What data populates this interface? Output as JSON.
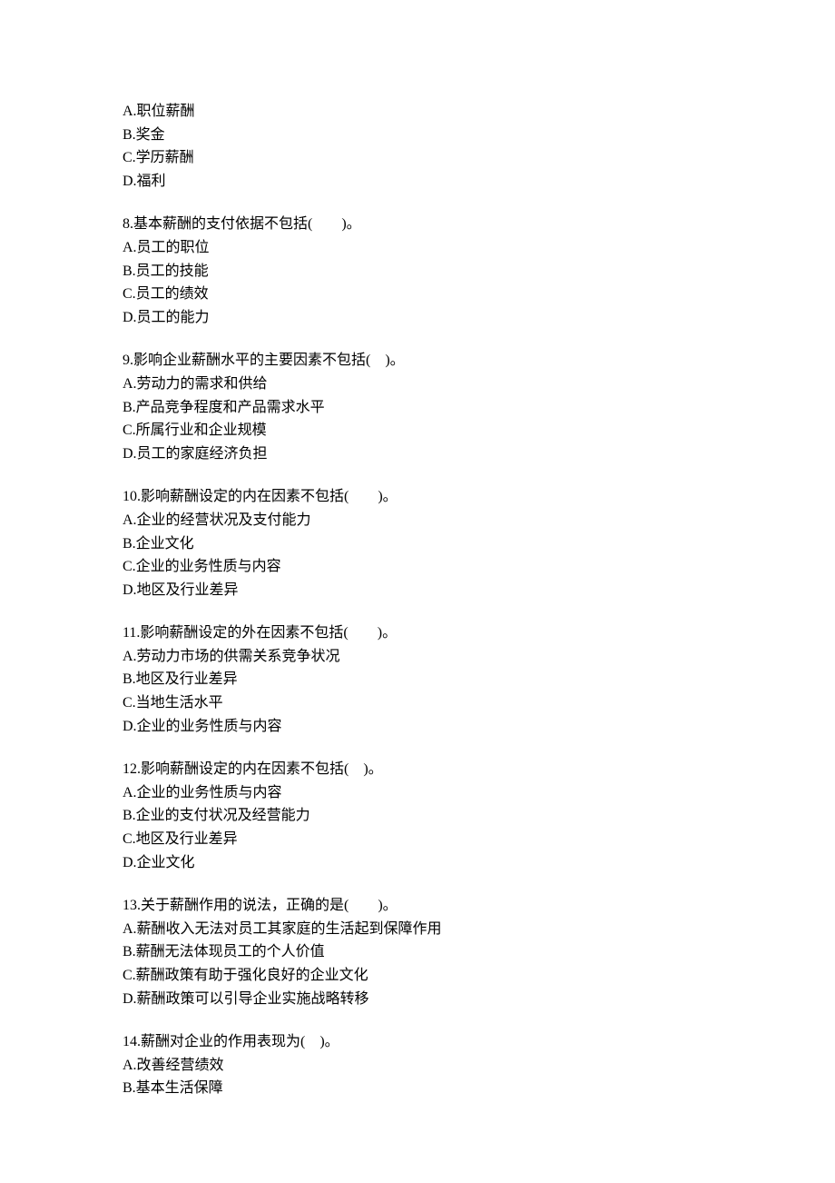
{
  "orphan_choices": {
    "a": "A.职位薪酬",
    "b": "B.奖金",
    "c": "C.学历薪酬",
    "d": "D.福利"
  },
  "questions": [
    {
      "stem": "8.基本薪酬的支付依据不包括(　　)。",
      "a": "A.员工的职位",
      "b": "B.员工的技能",
      "c": "C.员工的绩效",
      "d": "D.员工的能力"
    },
    {
      "stem": "9.影响企业薪酬水平的主要因素不包括(　)。",
      "a": "A.劳动力的需求和供给",
      "b": "B.产品竞争程度和产品需求水平",
      "c": "C.所属行业和企业规模",
      "d": "D.员工的家庭经济负担"
    },
    {
      "stem": "10.影响薪酬设定的内在因素不包括(　　)。",
      "a": "A.企业的经营状况及支付能力",
      "b": "B.企业文化",
      "c": "C.企业的业务性质与内容",
      "d": "D.地区及行业差异"
    },
    {
      "stem": "11.影响薪酬设定的外在因素不包括(　　)。",
      "a": "A.劳动力市场的供需关系竞争状况",
      "b": "B.地区及行业差异",
      "c": "C.当地生活水平",
      "d": "D.企业的业务性质与内容"
    },
    {
      "stem": "12.影响薪酬设定的内在因素不包括(　)。",
      "a": "A.企业的业务性质与内容",
      "b": "B.企业的支付状况及经营能力",
      "c": "C.地区及行业差异",
      "d": "D.企业文化"
    },
    {
      "stem": "13.关于薪酬作用的说法，正确的是(　　)。",
      "a": "A.薪酬收入无法对员工其家庭的生活起到保障作用",
      "b": "B.薪酬无法体现员工的个人价值",
      "c": "C.薪酬政策有助于强化良好的企业文化",
      "d": "D.薪酬政策可以引导企业实施战略转移"
    },
    {
      "stem": "14.薪酬对企业的作用表现为(　)。",
      "a": "A.改善经营绩效",
      "b": "B.基本生活保障"
    }
  ]
}
